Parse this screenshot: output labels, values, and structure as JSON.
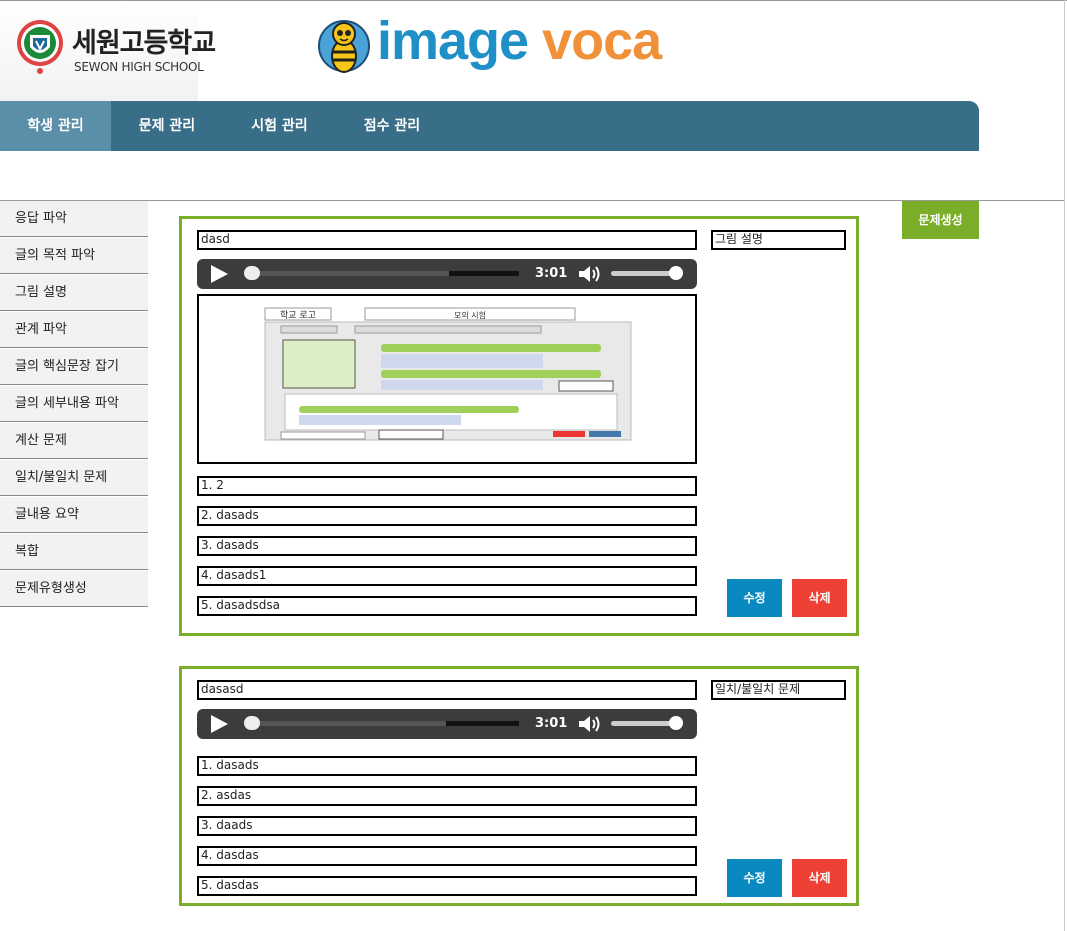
{
  "header": {
    "school_name_ko": "세원고등학교",
    "school_name_en": "SEWON HIGH SCHOOL",
    "brand": {
      "word1": "image",
      "word2": "voca",
      "color1": "#1f8fc7",
      "color2": "#f0913a"
    }
  },
  "nav": {
    "items": [
      {
        "label": "학생 관리",
        "active": true
      },
      {
        "label": "문제 관리"
      },
      {
        "label": "시험 관리"
      },
      {
        "label": "점수 관리"
      }
    ]
  },
  "sidebar": {
    "items": [
      {
        "label": "응답 파악"
      },
      {
        "label": "글의 목적 파악"
      },
      {
        "label": "그림 설명"
      },
      {
        "label": "관계 파악"
      },
      {
        "label": "글의 핵심문장 잡기"
      },
      {
        "label": "글의 세부내용 파악"
      },
      {
        "label": "계산 문제"
      },
      {
        "label": "일치/불일치 문제"
      },
      {
        "label": "글내용 요약"
      },
      {
        "label": "복합"
      },
      {
        "label": "문제유형생성"
      }
    ]
  },
  "create_button": "문제생성",
  "questions": [
    {
      "title": "dasd",
      "type": "그림 설명",
      "audio_time": "3:01",
      "audio_progress": 0.0,
      "has_image": true,
      "image": {
        "tab1": "학교 로고",
        "tab2": "모의 시험"
      },
      "options": [
        "1. 2",
        "2. dasads",
        "3. dasads",
        "4. dasads1",
        "5. dasadsdsa"
      ],
      "edit_label": "수정",
      "delete_label": "삭제"
    },
    {
      "title": "dasasd",
      "type": "일치/불일치 문제",
      "audio_time": "3:01",
      "audio_progress": 0.0,
      "has_image": false,
      "options": [
        "1. dasads",
        "2. asdas",
        "3. daads",
        "4. dasdas",
        "5. dasdas"
      ],
      "edit_label": "수정",
      "delete_label": "삭제"
    }
  ]
}
